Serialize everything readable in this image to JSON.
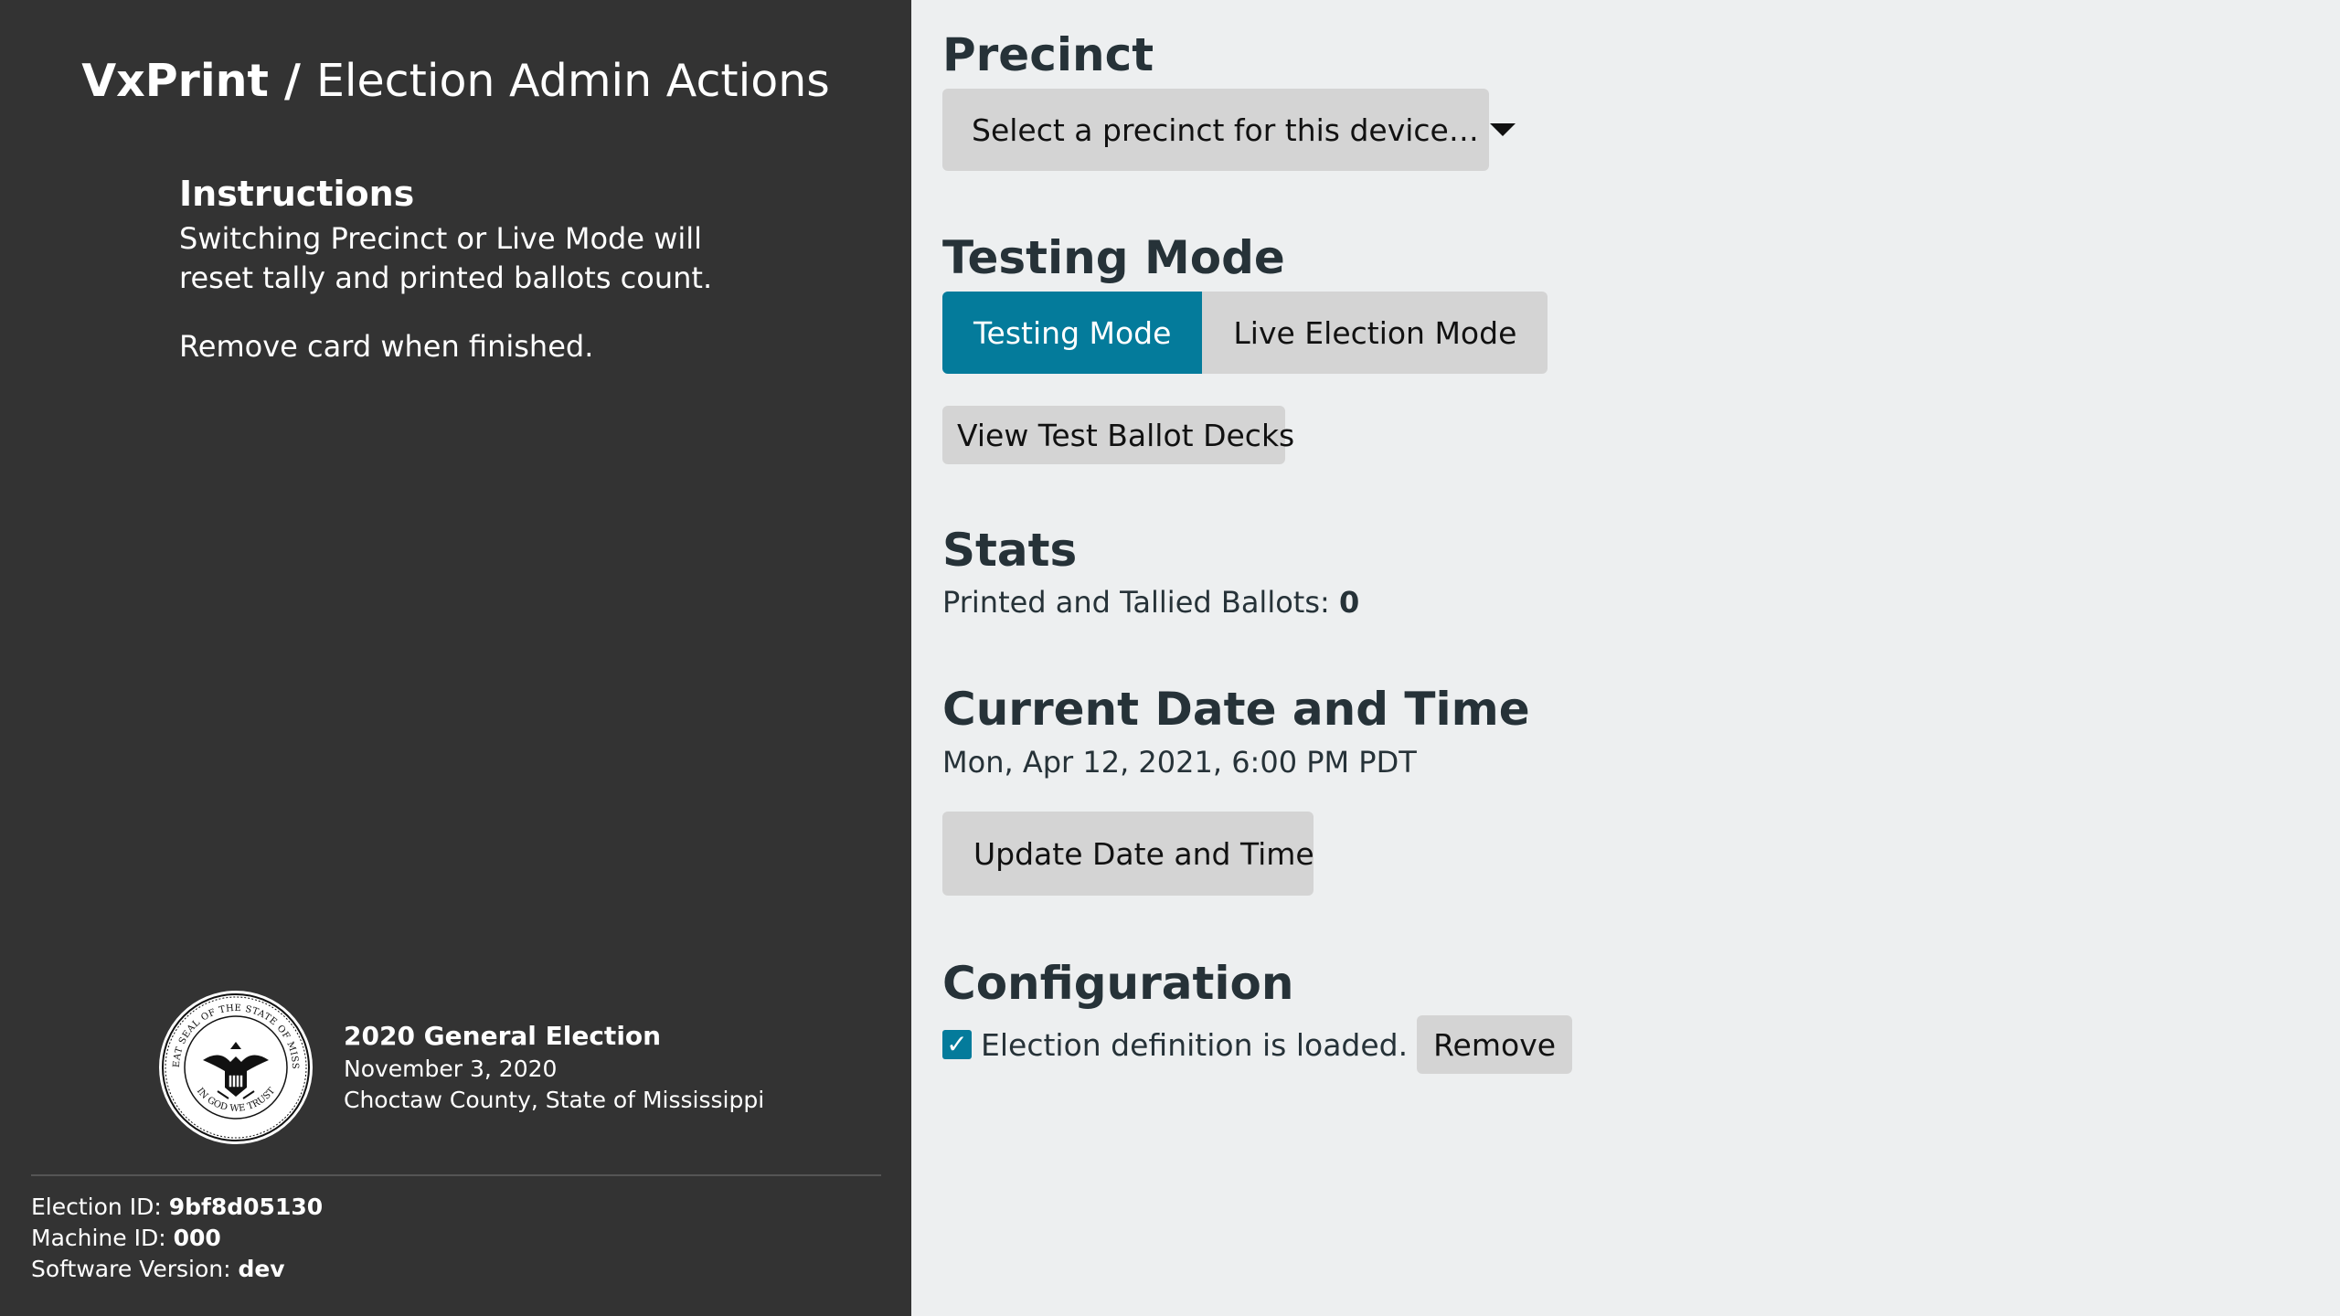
{
  "sidebar": {
    "app_name": "VxPrint",
    "separator": " / ",
    "page_name": "Election Admin Actions",
    "instructions": {
      "heading": "Instructions",
      "paragraph_1": "Switching Precinct or Live Mode will reset tally and printed ballots count.",
      "paragraph_2": "Remove card when finished."
    },
    "election": {
      "title": "2020 General Election",
      "date": "November 3, 2020",
      "location": "Choctaw County, State of Mississippi",
      "seal_text_top": "THE GREAT SEAL OF THE STATE OF MISSISSIPPI",
      "seal_text_bottom": "IN GOD WE TRUST"
    },
    "machine_info": {
      "election_id_label": "Election ID: ",
      "election_id": "9bf8d05130",
      "machine_id_label": "Machine ID: ",
      "machine_id": "000",
      "software_version_label": "Software Version: ",
      "software_version": "dev"
    }
  },
  "main": {
    "precinct": {
      "heading": "Precinct",
      "select_placeholder": "Select a precinct for this device…"
    },
    "testing_mode": {
      "heading": "Testing Mode",
      "options": [
        {
          "label": "Testing Mode",
          "active": true
        },
        {
          "label": "Live Election Mode",
          "active": false
        }
      ],
      "view_test_decks_label": "View Test Ballot Decks"
    },
    "stats": {
      "heading": "Stats",
      "printed_tallied_label": "Printed and Tallied Ballots: ",
      "printed_tallied_value": "0"
    },
    "datetime": {
      "heading": "Current Date and Time",
      "value": "Mon, Apr 12, 2021, 6:00 PM PDT",
      "update_button_label": "Update Date and Time"
    },
    "configuration": {
      "heading": "Configuration",
      "status_text": "Election definition is loaded.",
      "checked": true,
      "remove_button_label": "Remove"
    }
  },
  "colors": {
    "sidebar_bg": "#333333",
    "main_bg": "#edeff0",
    "accent": "#047b9b",
    "button_bg": "#d4d4d4",
    "heading_text": "#263238"
  },
  "icons": {
    "dropdown": "caret-down-icon",
    "checkbox": "checkmark-icon",
    "seal": "mississippi-state-seal"
  }
}
